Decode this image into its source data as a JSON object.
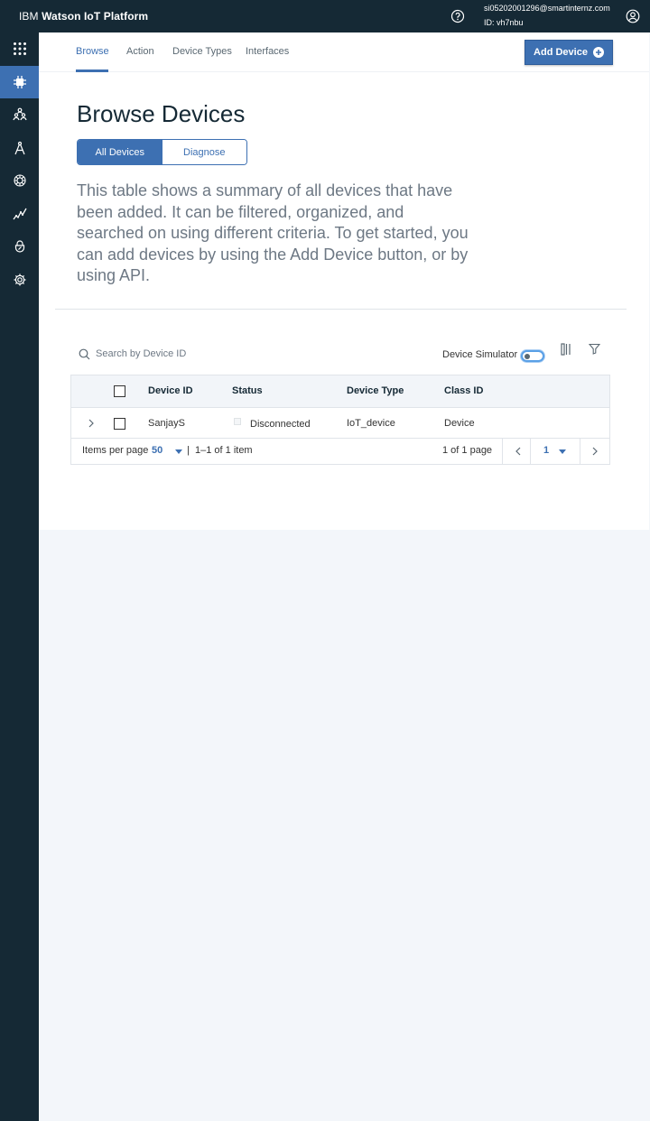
{
  "topbar": {
    "brand_prefix": "IBM ",
    "brand_name": "Watson IoT Platform",
    "user_email": "si05202001296@smartinternz.com",
    "user_id": "ID: vh7nbu"
  },
  "sidebar": {
    "items": [
      {
        "icon": "apps-grid-icon"
      },
      {
        "icon": "devices-chip-icon",
        "active": true
      },
      {
        "icon": "members-icon"
      },
      {
        "icon": "apps-compass-icon"
      },
      {
        "icon": "rules-icon"
      },
      {
        "icon": "usage-chart-icon"
      },
      {
        "icon": "security-lock-icon"
      },
      {
        "icon": "settings-gear-icon"
      }
    ]
  },
  "tabs": [
    {
      "label": "Browse",
      "active": true
    },
    {
      "label": "Action"
    },
    {
      "label": "Device Types"
    },
    {
      "label": "Interfaces"
    }
  ],
  "add_device_label": "Add Device",
  "page_title": "Browse Devices",
  "segmented": {
    "all": "All Devices",
    "diagnose": "Diagnose"
  },
  "description": "This table shows a summary of all devices that have been added. It can be filtered, organized, and searched on using different criteria. To get started, you can add devices by using the Add Device button, or by using API.",
  "search": {
    "placeholder": "Search by Device ID",
    "value": ""
  },
  "simulator_label": "Device Simulator",
  "table": {
    "columns": [
      "Device ID",
      "Status",
      "Device Type",
      "Class ID"
    ],
    "rows": [
      {
        "device_id": "SanjayS",
        "status": "Disconnected",
        "device_type": "IoT_device",
        "class_id": "Device"
      }
    ]
  },
  "pagination": {
    "items_per_page_label": "Items per page",
    "items_per_page": "50",
    "separator": "|",
    "range": "1–1 of 1 item",
    "page_of": "1 of 1 page",
    "current_page": "1"
  },
  "colors": {
    "accent": "#3d70b2",
    "topbar": "#152935",
    "background": "#f3f6fa"
  }
}
